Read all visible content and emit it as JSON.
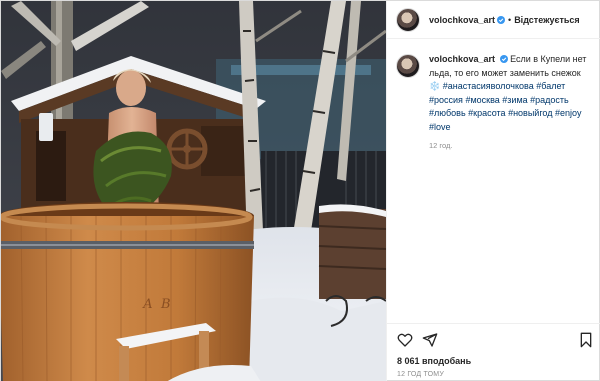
{
  "post": {
    "username": "volochkova_art",
    "follow_label": "Відстежується",
    "separator": "•",
    "caption": {
      "text_before": "Если в Купели нет льда, то его может заменить снежок ❄️",
      "hashtags": [
        "#анастасияволочкова",
        "#балет",
        "#россия",
        "#москва",
        "#зима",
        "#радость",
        "#любовь",
        "#красота",
        "#новыйгод",
        "#enjoy",
        "#love"
      ],
      "time": "12 год."
    },
    "likes": "8 061 вподобань",
    "timestamp": "12 ГОД ТОМУ",
    "tub_monogram": "А В"
  },
  "colors": {
    "text": "#262626",
    "muted": "#8e8e8e",
    "hashtag": "#00376b",
    "verified": "#3897f0",
    "border": "#dbdbdb"
  },
  "icons": [
    "verified-badge-icon",
    "heart-icon",
    "share-icon",
    "bookmark-icon"
  ]
}
